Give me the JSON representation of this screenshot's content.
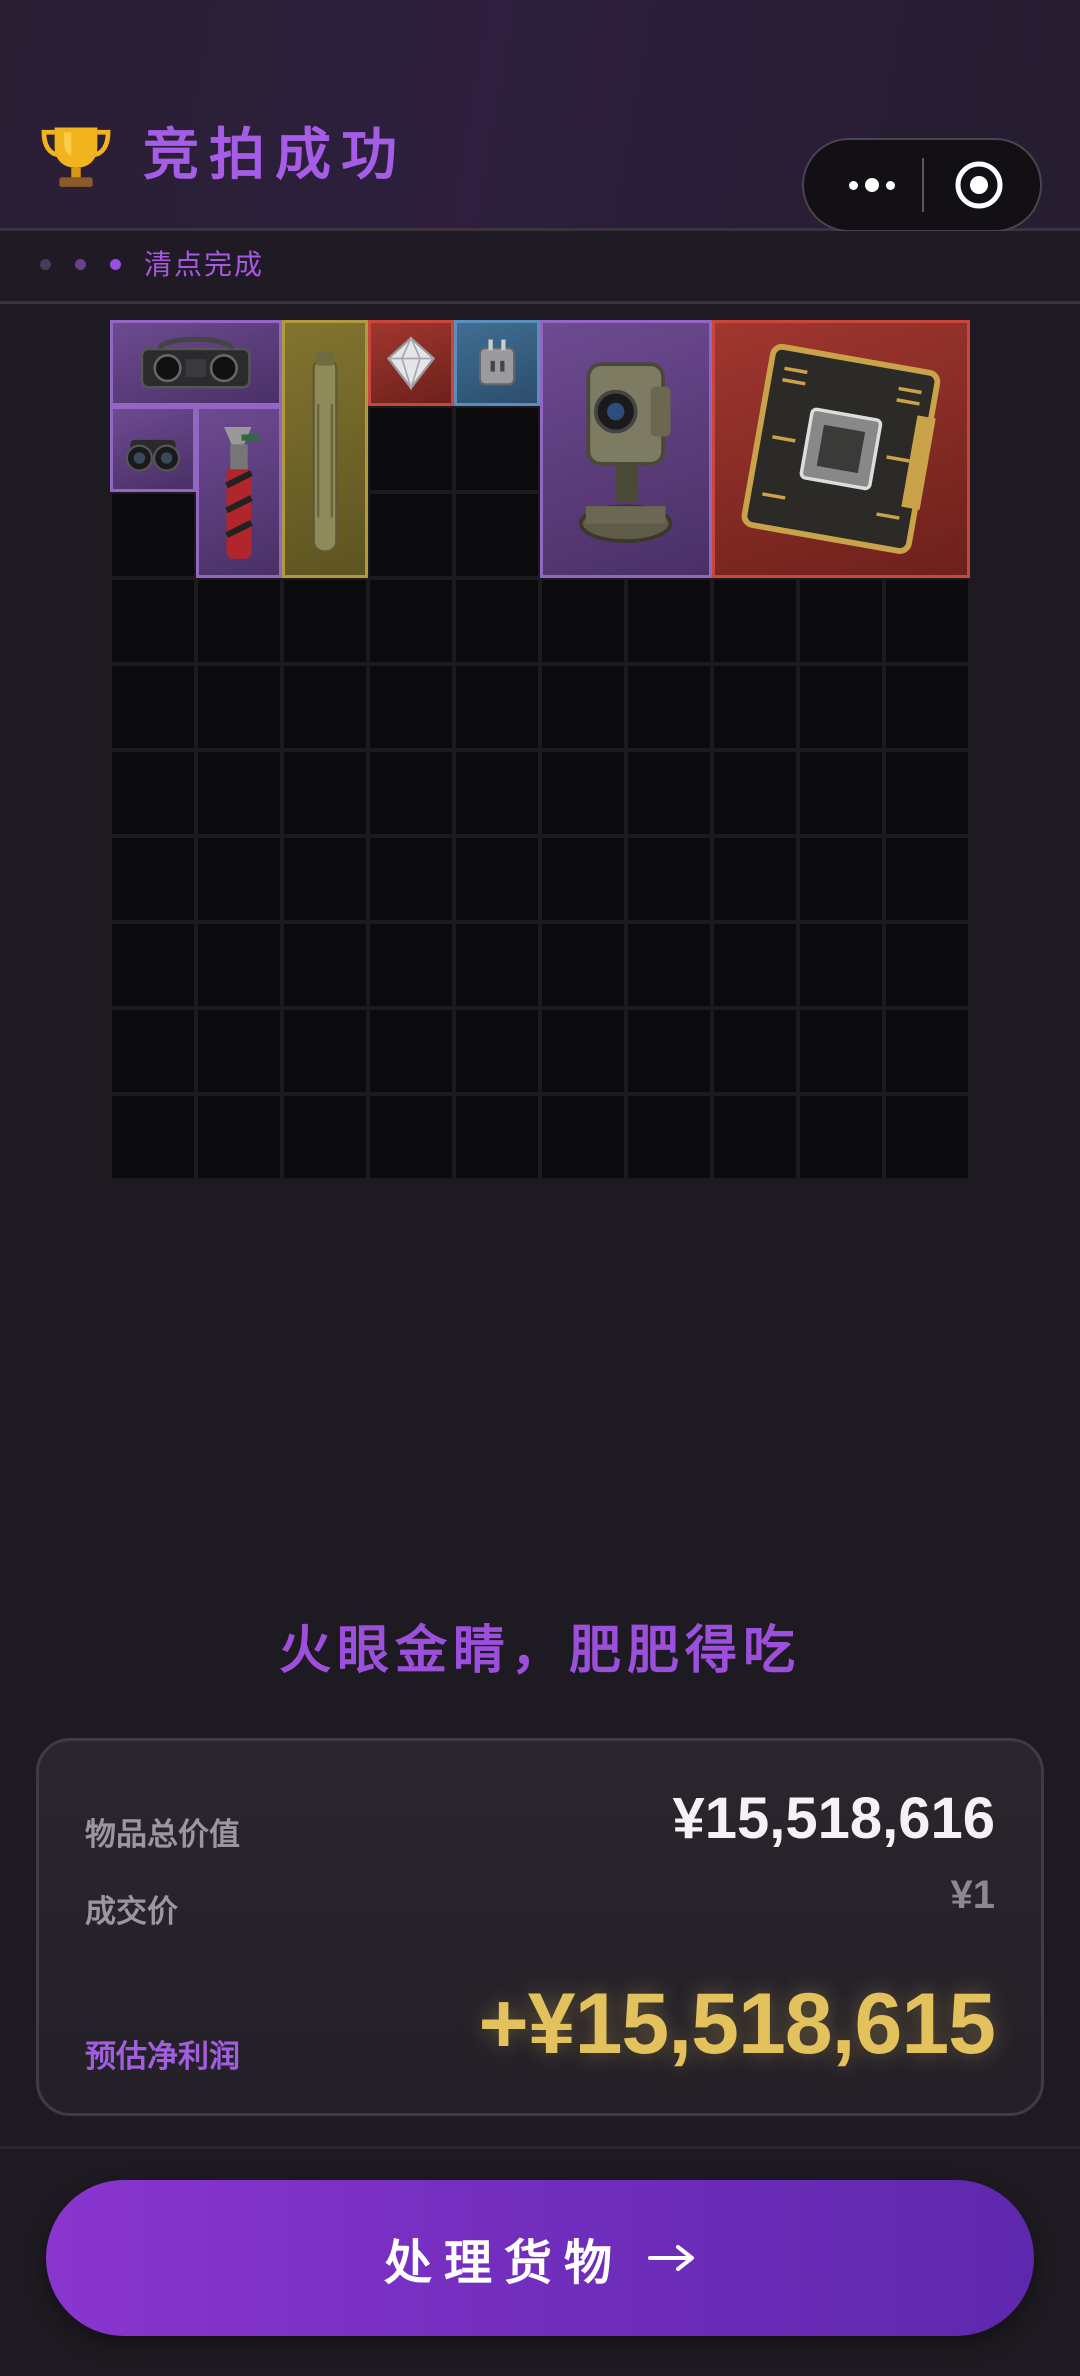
{
  "header": {
    "title": "竞拍成功",
    "trophy_icon": "trophy-icon",
    "menu_icon": "more-dots-icon",
    "target_icon": "record-target-icon"
  },
  "status": {
    "text": "清点完成",
    "dot_colors": [
      "#4a3a5a",
      "#6a3f8f",
      "#9d4ee0"
    ]
  },
  "inventory": {
    "columns": 10,
    "rows": 10,
    "items": [
      {
        "name": "boombox-icon",
        "rarity": "purple",
        "col": 0,
        "row": 0,
        "w": 2,
        "h": 1
      },
      {
        "name": "night-vision-goggles-icon",
        "rarity": "purple",
        "col": 0,
        "row": 1,
        "w": 1,
        "h": 1
      },
      {
        "name": "blowtorch-icon",
        "rarity": "purple",
        "col": 1,
        "row": 1,
        "w": 1,
        "h": 2
      },
      {
        "name": "tube-canister-icon",
        "rarity": "gold",
        "col": 2,
        "row": 0,
        "w": 1,
        "h": 3
      },
      {
        "name": "diamond-icon",
        "rarity": "red",
        "col": 3,
        "row": 0,
        "w": 1,
        "h": 1
      },
      {
        "name": "power-adapter-icon",
        "rarity": "blue",
        "col": 4,
        "row": 0,
        "w": 1,
        "h": 1
      },
      {
        "name": "camera-turret-icon",
        "rarity": "purple",
        "col": 5,
        "row": 0,
        "w": 2,
        "h": 3
      },
      {
        "name": "circuit-board-icon",
        "rarity": "red",
        "col": 7,
        "row": 0,
        "w": 3,
        "h": 3
      }
    ]
  },
  "slogan": "火眼金睛，肥肥得吃",
  "summary": {
    "total_label": "物品总价值",
    "total_value": "¥15,518,616",
    "deal_label": "成交价",
    "deal_value": "¥1",
    "profit_label": "预估净利润",
    "profit_value": "+¥15,518,615"
  },
  "cta": {
    "label": "处理货物",
    "arrow_icon": "arrow-right-icon"
  }
}
